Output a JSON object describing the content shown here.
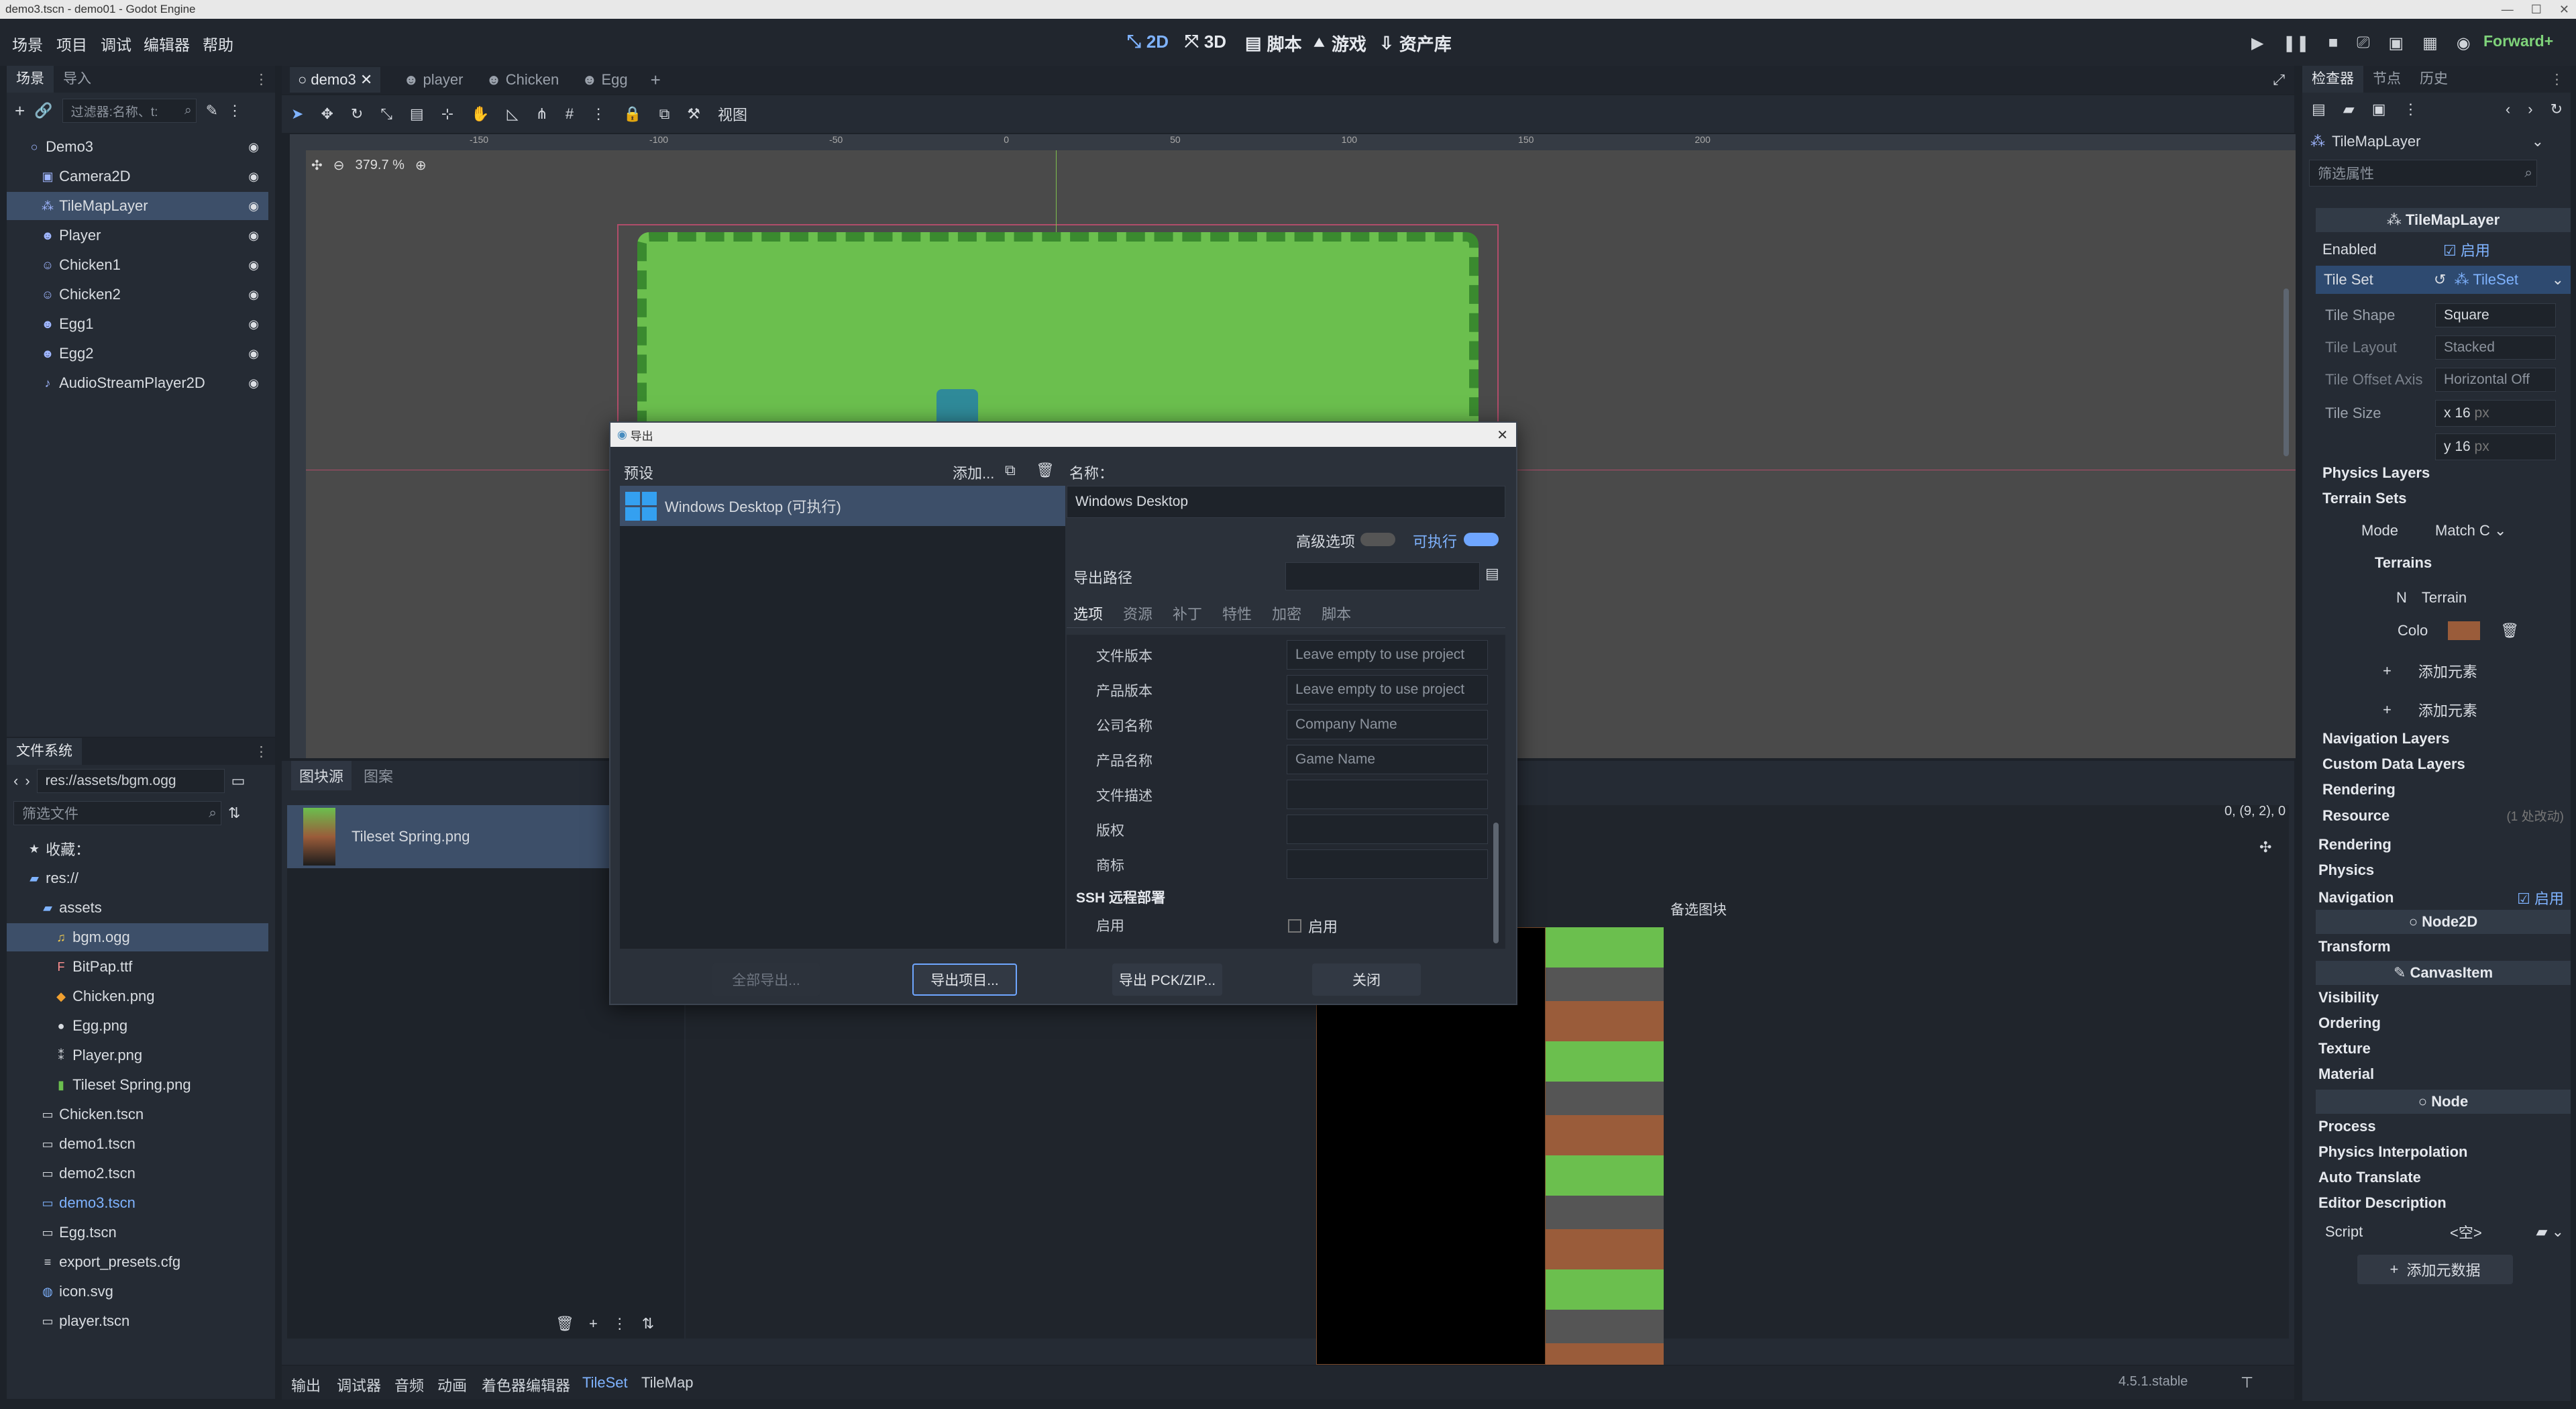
{
  "window": {
    "title": "demo3.tscn - demo01 - Godot Engine"
  },
  "menu": [
    "场景",
    "项目",
    "调试",
    "编辑器",
    "帮助"
  ],
  "workspaces": [
    "2D",
    "3D",
    "脚本",
    "游戏",
    "资产库"
  ],
  "renderer": "Forward+",
  "scene_dock": {
    "tabs": [
      "场景",
      "导入"
    ],
    "filter_placeholder": "过滤器:名称、t:",
    "nodes": [
      {
        "label": "Demo3",
        "icon": "node2d-icon"
      },
      {
        "label": "Camera2D",
        "icon": "camera-icon"
      },
      {
        "label": "TileMapLayer",
        "icon": "tilemap-icon"
      },
      {
        "label": "Player",
        "icon": "character-icon"
      },
      {
        "label": "Chicken1",
        "icon": "character-icon"
      },
      {
        "label": "Chicken2",
        "icon": "character-icon"
      },
      {
        "label": "Egg1",
        "icon": "character-icon"
      },
      {
        "label": "Egg2",
        "icon": "character-icon"
      },
      {
        "label": "AudioStreamPlayer2D",
        "icon": "audio-icon"
      }
    ]
  },
  "filesystem_dock": {
    "title": "文件系统",
    "path": "res://assets/bgm.ogg",
    "filter_placeholder": "筛选文件",
    "favorites_label": "收藏：",
    "items": [
      {
        "label": "res://",
        "icon": "folder-icon"
      },
      {
        "label": "assets",
        "icon": "folder-icon"
      },
      {
        "label": "bgm.ogg",
        "icon": "audio-file-icon"
      },
      {
        "label": "BitPap.ttf",
        "icon": "font-icon"
      },
      {
        "label": "Chicken.png",
        "icon": "image-icon"
      },
      {
        "label": "Egg.png",
        "icon": "image-icon"
      },
      {
        "label": "Player.png",
        "icon": "image-icon"
      },
      {
        "label": "Tileset Spring.png",
        "icon": "image-icon"
      },
      {
        "label": "Chicken.tscn",
        "icon": "scene-icon"
      },
      {
        "label": "demo1.tscn",
        "icon": "scene-icon"
      },
      {
        "label": "demo2.tscn",
        "icon": "scene-icon"
      },
      {
        "label": "demo3.tscn",
        "icon": "scene-icon"
      },
      {
        "label": "Egg.tscn",
        "icon": "scene-icon"
      },
      {
        "label": "export_presets.cfg",
        "icon": "config-icon"
      },
      {
        "label": "icon.svg",
        "icon": "svg-icon"
      },
      {
        "label": "player.tscn",
        "icon": "scene-icon"
      }
    ]
  },
  "scene_tabs": [
    "demo3",
    "player",
    "Chicken",
    "Egg"
  ],
  "viewport": {
    "zoom": "379.7 %",
    "view_menu": "视图",
    "ruler_labels": [
      "-150",
      "-100",
      "-50",
      "0",
      "50",
      "100",
      "150",
      "200"
    ]
  },
  "tileset_panel": {
    "tabs": [
      "图块源",
      "图案"
    ],
    "source": "Tileset Spring.png",
    "coords": "0, (9, 2), 0",
    "alt_tiles": "备选图块"
  },
  "export_dialog": {
    "title": "导出",
    "presets_label": "预设",
    "add_label": "添加...",
    "preset": "Windows Desktop (可执行)",
    "name_label": "名称：",
    "name_value": "Windows Desktop",
    "advanced_label": "高级选项",
    "runnable_label": "可执行",
    "export_path_label": "导出路径",
    "tabs": [
      "选项",
      "资源",
      "补丁",
      "特性",
      "加密",
      "脚本"
    ],
    "fields": [
      {
        "label": "文件版本",
        "placeholder": "Leave empty to use project"
      },
      {
        "label": "产品版本",
        "placeholder": "Leave empty to use project"
      },
      {
        "label": "公司名称",
        "placeholder": "Company Name"
      },
      {
        "label": "产品名称",
        "placeholder": "Game Name"
      },
      {
        "label": "文件描述",
        "placeholder": ""
      },
      {
        "label": "版权",
        "placeholder": ""
      },
      {
        "label": "商标",
        "placeholder": ""
      }
    ],
    "ssh_section": "SSH 远程部署",
    "ssh_enable_label": "启用",
    "ssh_enable_value": "启用",
    "buttons": {
      "export_all": "全部导出...",
      "export_project": "导出项目...",
      "export_pck": "导出 PCK/ZIP...",
      "close": "关闭"
    }
  },
  "inspector": {
    "tabs": [
      "检查器",
      "节点",
      "历史"
    ],
    "node_type": "TileMapLayer",
    "filter_placeholder": "筛选属性",
    "class_header": "TileMapLayer",
    "enabled_label": "Enabled",
    "enabled_value": "启用",
    "tileset_label": "Tile Set",
    "tileset_value": "TileSet",
    "tile_shape_label": "Tile Shape",
    "tile_shape_value": "Square",
    "tile_layout_label": "Tile Layout",
    "tile_layout_value": "Stacked",
    "tile_offset_label": "Tile Offset Axis",
    "tile_offset_value": "Horizontal Off",
    "tile_size_label": "Tile Size",
    "tile_size_x": "16",
    "tile_size_y": "16",
    "px": "px",
    "physics_layers": "Physics Layers",
    "terrain_sets": "Terrain Sets",
    "mode_label": "Mode",
    "mode_value": "Match C",
    "terrains": "Terrains",
    "terrain_name_label": "N",
    "terrain_name": "Terrain",
    "terrain_color_label": "Colo",
    "add_element": "添加元素",
    "navigation_layers": "Navigation Layers",
    "custom_data_layers": "Custom Data Layers",
    "rendering_inner": "Rendering",
    "resource": "Resource",
    "resource_note": "(1 处改动)",
    "sections": [
      "Rendering",
      "Physics",
      "Navigation"
    ],
    "navigation_enable": "启用",
    "node2d": "Node2D",
    "transform": "Transform",
    "canvas_item": "CanvasItem",
    "canvas_sections": [
      "Visibility",
      "Ordering",
      "Texture",
      "Material"
    ],
    "node": "Node",
    "node_sections": [
      "Process",
      "Physics Interpolation",
      "Auto Translate",
      "Editor Description"
    ],
    "script_label": "Script",
    "script_value": "<空>",
    "add_metadata": "添加元数据"
  },
  "bottom_tabs": [
    "输出",
    "调试器",
    "音频",
    "动画",
    "着色器编辑器",
    "TileSet",
    "TileMap"
  ],
  "version": "4.5.1.stable",
  "colors": {
    "accent": "#7fb3ff",
    "grass": "#6bbf4e",
    "terrain_color": "#9a5c3a",
    "selection": "#3d4f69"
  }
}
